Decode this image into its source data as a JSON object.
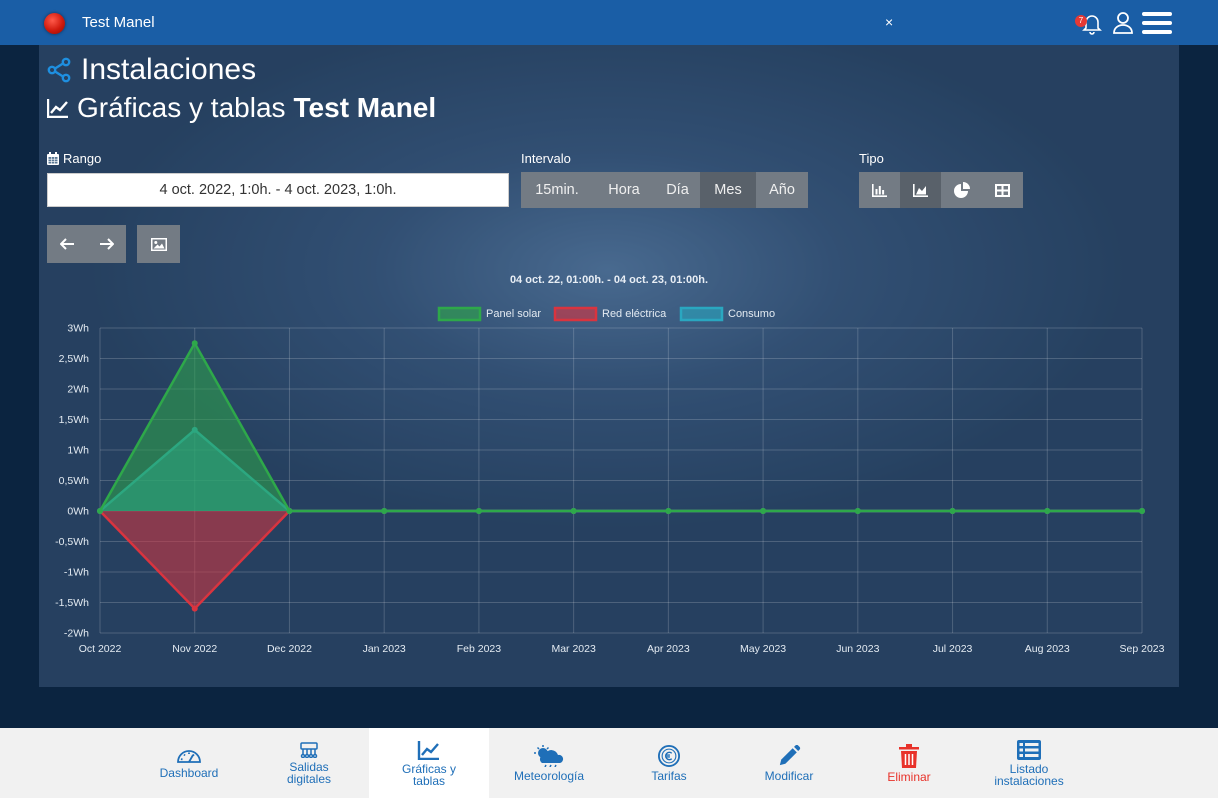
{
  "topbar": {
    "installation_name": "Test Manel",
    "close_label": "×",
    "notification_count": "7"
  },
  "page": {
    "title": "Instalaciones",
    "subtitle_prefix": "Gráficas y tablas",
    "subtitle_name": "Test Manel"
  },
  "controls": {
    "range_label": "Rango",
    "range_value": "4 oct. 2022, 1:0h. - 4 oct. 2023, 1:0h.",
    "interval_label": "Intervalo",
    "interval_options": [
      "15min.",
      "Hora",
      "Día",
      "Mes",
      "Año"
    ],
    "interval_selected": "Mes",
    "type_label": "Tipo",
    "type_options": [
      "bar-chart-icon",
      "area-chart-icon",
      "pie-chart-icon",
      "table-icon"
    ],
    "type_selected": "area-chart-icon"
  },
  "chart_data": {
    "type": "area",
    "title": "04 oct. 22, 01:00h. - 04 oct. 23, 01:00h.",
    "categories": [
      "Oct 2022",
      "Nov 2022",
      "Dec 2022",
      "Jan 2023",
      "Feb 2023",
      "Mar 2023",
      "Apr 2023",
      "May 2023",
      "Jun 2023",
      "Jul 2023",
      "Aug 2023",
      "Sep 2023"
    ],
    "series": [
      {
        "name": "Panel solar",
        "color": "#2ea84a",
        "values": [
          0,
          2.75,
          0,
          0,
          0,
          0,
          0,
          0,
          0,
          0,
          0,
          0
        ]
      },
      {
        "name": "Red eléctrica",
        "color": "#d9343f",
        "values": [
          0,
          -1.6,
          0,
          0,
          0,
          0,
          0,
          0,
          0,
          0,
          0,
          0
        ]
      },
      {
        "name": "Consumo",
        "color": "#2aa7c0",
        "values": [
          0,
          1.33,
          0,
          0,
          0,
          0,
          0,
          0,
          0,
          0,
          0,
          0
        ]
      }
    ],
    "ylim": [
      -2,
      3
    ],
    "yticks": [
      "3Wh",
      "2,5Wh",
      "2Wh",
      "1,5Wh",
      "1Wh",
      "0,5Wh",
      "0Wh",
      "-0,5Wh",
      "-1Wh",
      "-1,5Wh",
      "-2Wh"
    ],
    "ytick_values": [
      3,
      2.5,
      2,
      1.5,
      1,
      0.5,
      0,
      -0.5,
      -1,
      -1.5,
      -2
    ],
    "legend_position": "top-center",
    "grid": true
  },
  "bottom_nav": [
    {
      "label": "Dashboard",
      "icon": "dashboard-icon"
    },
    {
      "label": "Salidas\ndigitales",
      "icon": "digital-outputs-icon"
    },
    {
      "label": "Gráficas y\ntablas",
      "icon": "line-chart-icon"
    },
    {
      "label": "Meteorología",
      "icon": "weather-icon"
    },
    {
      "label": "Tarifas",
      "icon": "euro-icon"
    },
    {
      "label": "Modificar",
      "icon": "pencil-icon"
    },
    {
      "label": "Eliminar",
      "icon": "trash-icon"
    },
    {
      "label": "Listado\ninstalaciones",
      "icon": "list-icon"
    }
  ],
  "colors": {
    "topbar": "#1a5ea6",
    "nav_text": "#1f6fb8",
    "danger": "#e8322a"
  }
}
